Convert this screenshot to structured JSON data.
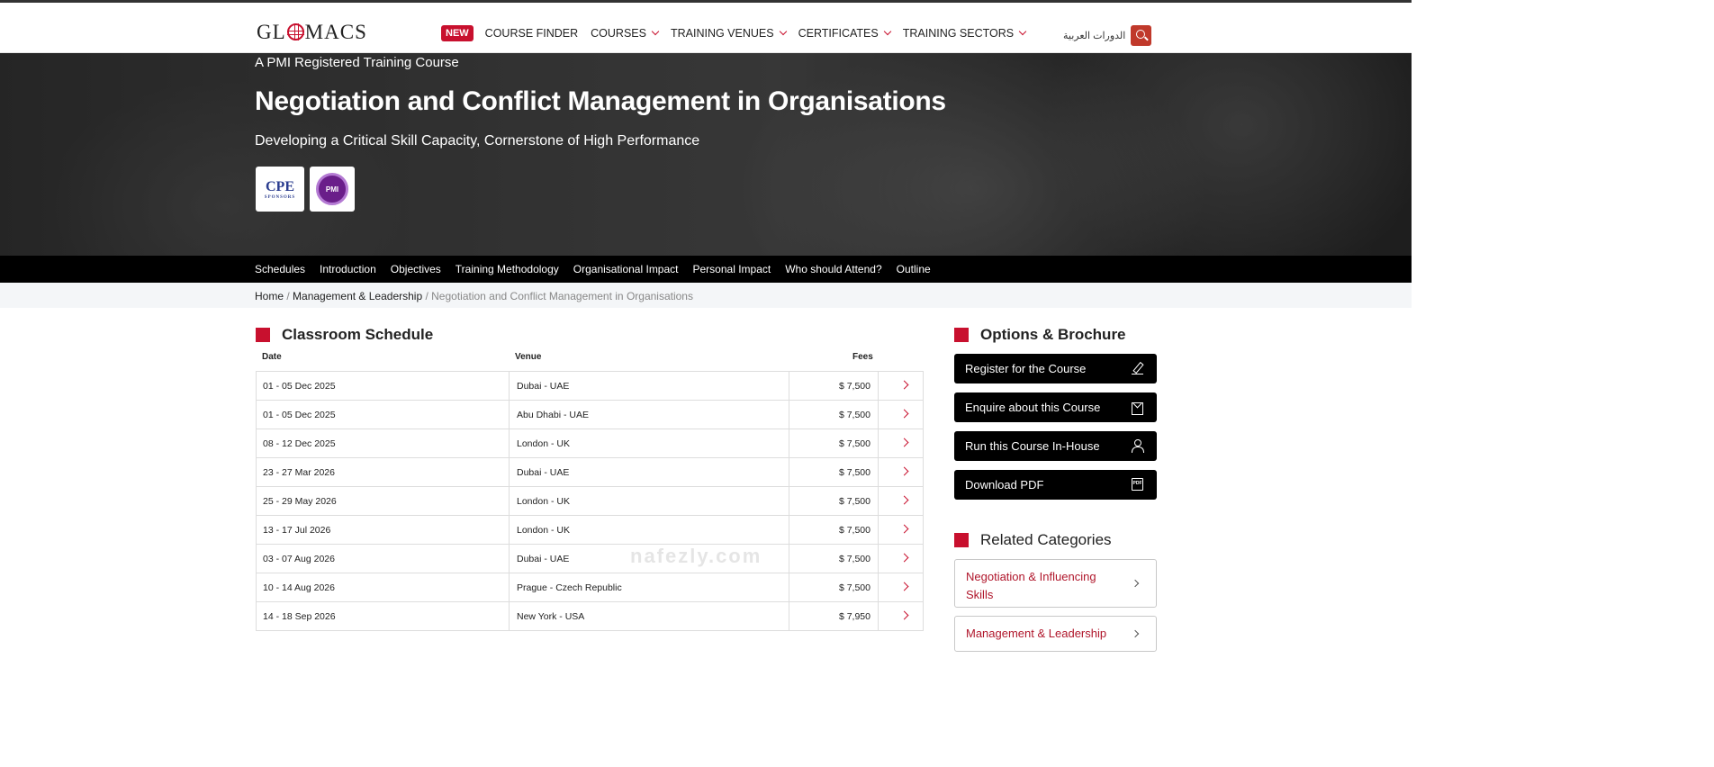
{
  "nav": {
    "logo": "GLOMACS",
    "new_badge": "NEW",
    "items": [
      "COURSE FINDER",
      "COURSES",
      "TRAINING VENUES",
      "CERTIFICATES",
      "TRAINING SECTORS"
    ],
    "arabic_link": "الدورات العربية"
  },
  "hero": {
    "kicker": "A PMI Registered Training Course",
    "title": "Negotiation and Conflict Management in Organisations",
    "subtitle": "Developing a Critical Skill Capacity, Cornerstone of High Performance",
    "cert_cpe": "CPE",
    "cert_cpe_sub": "SPONSORS",
    "cert_pmi": "PMI"
  },
  "tabs": [
    "Schedules",
    "Introduction",
    "Objectives",
    "Training Methodology",
    "Organisational Impact",
    "Personal Impact",
    "Who should Attend?",
    "Outline"
  ],
  "breadcrumb": {
    "home": "Home",
    "category": "Management & Leadership",
    "current": "Negotiation and Conflict Management in Organisations"
  },
  "schedule": {
    "title": "Classroom Schedule",
    "headers": {
      "date": "Date",
      "venue": "Venue",
      "fees": "Fees"
    },
    "rows": [
      {
        "date": "01 - 05 Dec 2025",
        "venue": "Dubai - UAE",
        "fees": "$ 7,500"
      },
      {
        "date": "01 - 05 Dec 2025",
        "venue": "Abu Dhabi - UAE",
        "fees": "$ 7,500"
      },
      {
        "date": "08 - 12 Dec 2025",
        "venue": "London - UK",
        "fees": "$ 7,500"
      },
      {
        "date": "23 - 27 Mar 2026",
        "venue": "Dubai - UAE",
        "fees": "$ 7,500"
      },
      {
        "date": "25 - 29 May 2026",
        "venue": "London - UK",
        "fees": "$ 7,500"
      },
      {
        "date": "13 - 17 Jul 2026",
        "venue": "London - UK",
        "fees": "$ 7,500"
      },
      {
        "date": "03 - 07 Aug 2026",
        "venue": "Dubai - UAE",
        "fees": "$ 7,500"
      },
      {
        "date": "10 - 14 Aug 2026",
        "venue": "Prague - Czech Republic",
        "fees": "$ 7,500"
      },
      {
        "date": "14 - 18 Sep 2026",
        "venue": "New York - USA",
        "fees": "$ 7,950"
      }
    ]
  },
  "options": {
    "title": "Options & Brochure",
    "register": "Register for the Course",
    "enquire": "Enquire about this Course",
    "inhouse": "Run this Course In-House",
    "pdf": "Download PDF",
    "pdf_icon_text": "PDF"
  },
  "related": {
    "title": "Related Categories",
    "items": [
      "Negotiation & Influencing Skills",
      "Management & Leadership"
    ]
  },
  "watermark": "nafezly.com",
  "colors": {
    "accent": "#c8102e",
    "dark": "#000000"
  }
}
